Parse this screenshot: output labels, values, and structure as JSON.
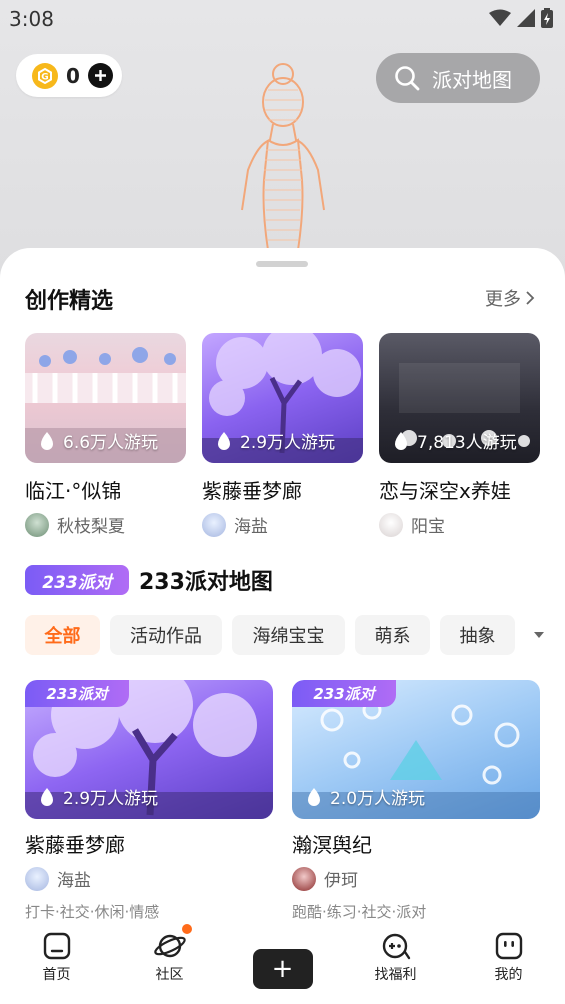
{
  "status": {
    "time": "3:08"
  },
  "coins": {
    "value": "0"
  },
  "search": {
    "label": "派对地图"
  },
  "creation": {
    "title": "创作精选",
    "more": "更多",
    "cards": [
      {
        "title": "临江·°似锦",
        "plays": "6.6万人游玩",
        "author": "秋枝梨夏"
      },
      {
        "title": "紫藤垂梦廊",
        "plays": "2.9万人游玩",
        "author": "海盐"
      },
      {
        "title": "恋与深空x养娃",
        "plays": "7,813人游玩",
        "author": "阳宝"
      }
    ]
  },
  "party": {
    "logo": "233派对",
    "title": "233派对地图",
    "tags": [
      "全部",
      "活动作品",
      "海绵宝宝",
      "萌系",
      "抽象"
    ],
    "cards": [
      {
        "badge": "233派对",
        "title": "紫藤垂梦廊",
        "plays": "2.9万人游玩",
        "author": "海盐",
        "tags": "打卡·社交·休闲·情感"
      },
      {
        "badge": "233派对",
        "title": "瀚溟舆纪",
        "plays": "2.0万人游玩",
        "author": "伊珂",
        "tags": "跑酷·练习·社交·派对"
      }
    ]
  },
  "tabbar": {
    "home": "首页",
    "community": "社区",
    "create": "+",
    "rewards": "找福利",
    "mine": "我的"
  },
  "colors": {
    "accent": "#ff6b1a",
    "brand_purple": "#7b5cf5",
    "coin": "#f7b81b"
  },
  "icons": [
    "wifi-icon",
    "signal-icon",
    "battery-icon",
    "coin-icon",
    "plus-icon",
    "search-icon",
    "chevron-right-icon",
    "fire-icon",
    "chevron-down-icon",
    "home-icon",
    "planet-icon",
    "gamepad-icon",
    "face-icon"
  ]
}
